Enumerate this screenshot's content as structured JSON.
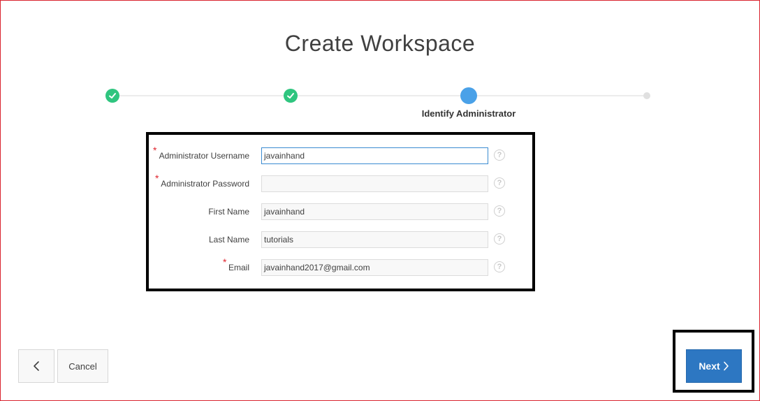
{
  "page": {
    "title": "Create Workspace"
  },
  "wizard": {
    "total_steps": 4,
    "current_step": 3,
    "current_label": "Identify Administrator"
  },
  "form": {
    "fields": [
      {
        "label": "Administrator Username",
        "value": "javainhand",
        "required": true
      },
      {
        "label": "Administrator Password",
        "value": "",
        "required": true
      },
      {
        "label": "First Name",
        "value": "javainhand",
        "required": false
      },
      {
        "label": "Last Name",
        "value": "tutorials",
        "required": false
      },
      {
        "label": "Email",
        "value": "javainhand2017@gmail.com",
        "required": true
      }
    ],
    "required_marker": "*",
    "help_glyph": "?"
  },
  "footer": {
    "cancel_label": "Cancel",
    "next_label": "Next"
  },
  "colors": {
    "done": "#2fc57f",
    "current": "#4aa1e8",
    "primary_button": "#2d77c2",
    "required": "#e0262f"
  }
}
